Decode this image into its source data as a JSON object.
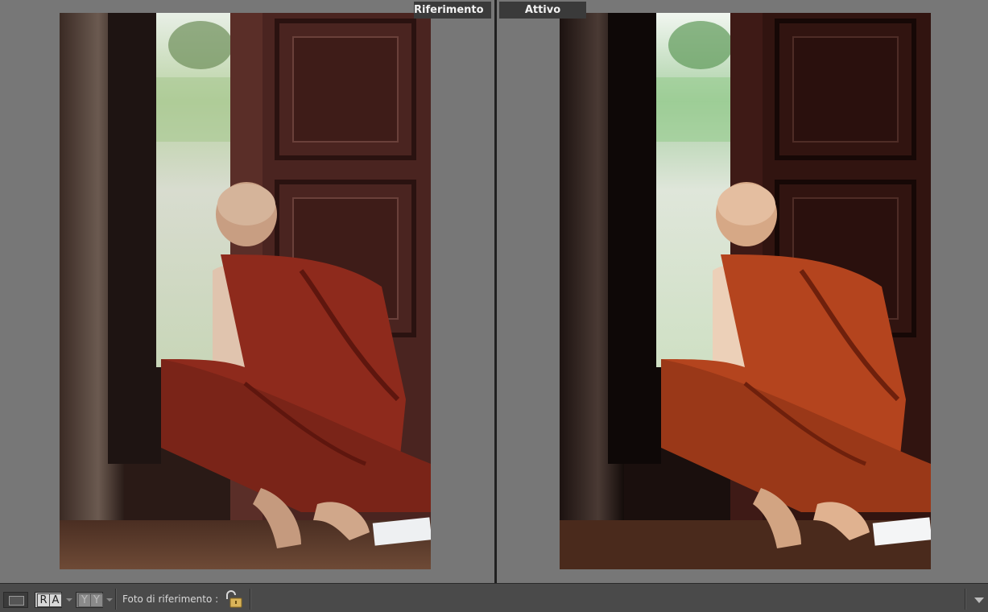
{
  "panes": {
    "reference_label": "Riferimento",
    "active_label": "Attivo"
  },
  "photos": {
    "reference_description_icon": "photo-monk-reference",
    "active_description_icon": "photo-monk-active"
  },
  "toolbar": {
    "view_loupe_icon": "single-view-icon",
    "ra_letters": [
      "R",
      "A"
    ],
    "yy_letters": [
      "Y",
      "Y"
    ],
    "reference_photo_label": "Foto di riferimento :",
    "lock_icon": "unlocked-padlock-icon",
    "menu_icon": "chevron-down-icon"
  },
  "colors": {
    "background": "#777777",
    "toolbar": "#4a4a4a",
    "label_bg": "#3a3a3a",
    "robe_reference": "#9a2e1e",
    "robe_active": "#b9461f"
  }
}
